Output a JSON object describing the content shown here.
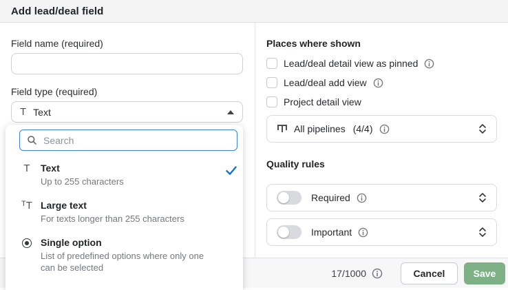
{
  "modal": {
    "title": "Add lead/deal field",
    "close_icon": "close-icon"
  },
  "left": {
    "field_name_label": "Field name (required)",
    "field_name_value": "",
    "field_type_label": "Field type (required)",
    "field_type_value": "Text",
    "field_type_icon": "text-type-icon",
    "dropdown": {
      "search_placeholder": "Search",
      "search_icon": "search-icon",
      "options": [
        {
          "icon": "text-type-icon",
          "title": "Text",
          "description": "Up to 255 characters",
          "selected": true
        },
        {
          "icon": "large-text-type-icon",
          "title": "Large text",
          "description": "For texts longer than 255 characters",
          "selected": false
        },
        {
          "icon": "single-option-type-icon",
          "title": "Single option",
          "description": "List of predefined options where only one can be selected",
          "selected": false
        }
      ]
    }
  },
  "right": {
    "places_header": "Places where shown",
    "checkboxes": [
      {
        "label": "Lead/deal detail view as pinned",
        "checked": false,
        "info_icon": true
      },
      {
        "label": "Lead/deal add view",
        "checked": false,
        "info_icon": true
      },
      {
        "label": "Project detail view",
        "checked": false,
        "info_icon": false
      }
    ],
    "pipelines": {
      "icon": "pipeline-icon",
      "label": "All pipelines",
      "count": "(4/4)",
      "info_icon": true,
      "expand_icon": "unfold-icon"
    },
    "quality_header": "Quality rules",
    "rules": [
      {
        "label": "Required",
        "enabled": false,
        "info_icon": true,
        "expand_icon": "unfold-icon"
      },
      {
        "label": "Important",
        "enabled": false,
        "info_icon": true,
        "expand_icon": "unfold-icon"
      }
    ]
  },
  "footer": {
    "counter": "17/1000",
    "info_icon": true,
    "cancel_label": "Cancel",
    "save_label": "Save"
  },
  "colors": {
    "header_bg": "#f4f4f5",
    "footer_bg": "#f7f7f8",
    "divider": "#dcdee1",
    "focus_blue": "#3b82e0",
    "check_blue": "#1570d1",
    "save_green": "#7eb086",
    "toggle_track": "#d8dadd"
  }
}
